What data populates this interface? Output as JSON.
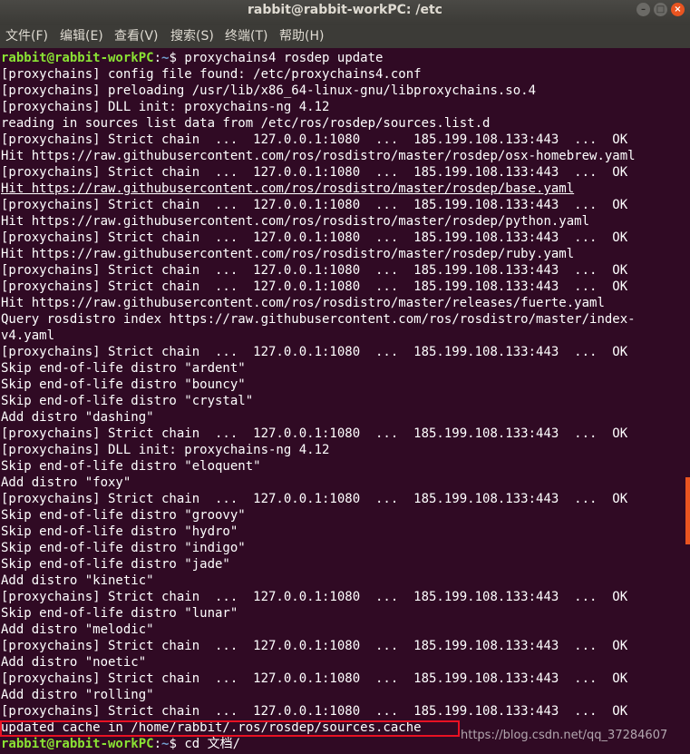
{
  "window": {
    "title": "rabbit@rabbit-workPC: /etc",
    "minimize_symbol": "–",
    "maximize_symbol": "□",
    "close_symbol": "×"
  },
  "menu": {
    "items": [
      "文件(F)",
      "编辑(E)",
      "查看(V)",
      "搜索(S)",
      "终端(T)",
      "帮助(H)"
    ]
  },
  "colors": {
    "background": "#300a24",
    "prompt_user": "#8ae234",
    "prompt_path": "#729fcf",
    "highlight_box": "#e81123",
    "scrollbar": "#e95420"
  },
  "terminal": {
    "prompt_user": "rabbit@rabbit-workPC",
    "prompt_colon": ":",
    "prompt_path": "~",
    "prompt_symbol": "$",
    "command_1": " proxychains4 rosdep update",
    "output": [
      "[proxychains] config file found: /etc/proxychains4.conf",
      "[proxychains] preloading /usr/lib/x86_64-linux-gnu/libproxychains.so.4",
      "[proxychains] DLL init: proxychains-ng 4.12",
      "reading in sources list data from /etc/ros/rosdep/sources.list.d",
      "[proxychains] Strict chain  ...  127.0.0.1:1080  ...  185.199.108.133:443  ...  OK",
      "Hit https://raw.githubusercontent.com/ros/rosdistro/master/rosdep/osx-homebrew.yaml",
      "[proxychains] Strict chain  ...  127.0.0.1:1080  ...  185.199.108.133:443  ...  OK",
      "Hit https://raw.githubusercontent.com/ros/rosdistro/master/rosdep/base.yaml",
      "[proxychains] Strict chain  ...  127.0.0.1:1080  ...  185.199.108.133:443  ...  OK",
      "Hit https://raw.githubusercontent.com/ros/rosdistro/master/rosdep/python.yaml",
      "[proxychains] Strict chain  ...  127.0.0.1:1080  ...  185.199.108.133:443  ...  OK",
      "Hit https://raw.githubusercontent.com/ros/rosdistro/master/rosdep/ruby.yaml",
      "[proxychains] Strict chain  ...  127.0.0.1:1080  ...  185.199.108.133:443  ...  OK",
      "[proxychains] Strict chain  ...  127.0.0.1:1080  ...  185.199.108.133:443  ...  OK",
      "Hit https://raw.githubusercontent.com/ros/rosdistro/master/releases/fuerte.yaml",
      "Query rosdistro index https://raw.githubusercontent.com/ros/rosdistro/master/index-",
      "v4.yaml",
      "[proxychains] Strict chain  ...  127.0.0.1:1080  ...  185.199.108.133:443  ...  OK",
      "Skip end-of-life distro \"ardent\"",
      "Skip end-of-life distro \"bouncy\"",
      "Skip end-of-life distro \"crystal\"",
      "Add distro \"dashing\"",
      "[proxychains] Strict chain  ...  127.0.0.1:1080  ...  185.199.108.133:443  ...  OK",
      "[proxychains] DLL init: proxychains-ng 4.12",
      "Skip end-of-life distro \"eloquent\"",
      "Add distro \"foxy\"",
      "[proxychains] Strict chain  ...  127.0.0.1:1080  ...  185.199.108.133:443  ...  OK",
      "Skip end-of-life distro \"groovy\"",
      "Skip end-of-life distro \"hydro\"",
      "Skip end-of-life distro \"indigo\"",
      "Skip end-of-life distro \"jade\"",
      "Add distro \"kinetic\"",
      "[proxychains] Strict chain  ...  127.0.0.1:1080  ...  185.199.108.133:443  ...  OK",
      "Skip end-of-life distro \"lunar\"",
      "Add distro \"melodic\"",
      "[proxychains] Strict chain  ...  127.0.0.1:1080  ...  185.199.108.133:443  ...  OK",
      "Add distro \"noetic\"",
      "[proxychains] Strict chain  ...  127.0.0.1:1080  ...  185.199.108.133:443  ...  OK",
      "Add distro \"rolling\"",
      "[proxychains] Strict chain  ...  127.0.0.1:1080  ...  185.199.108.133:443  ...  OK",
      "updated cache in /home/rabbit/.ros/rosdep/sources.cache"
    ],
    "command_2": " cd 文档/"
  },
  "watermark": "https://blog.csdn.net/qq_37284607"
}
